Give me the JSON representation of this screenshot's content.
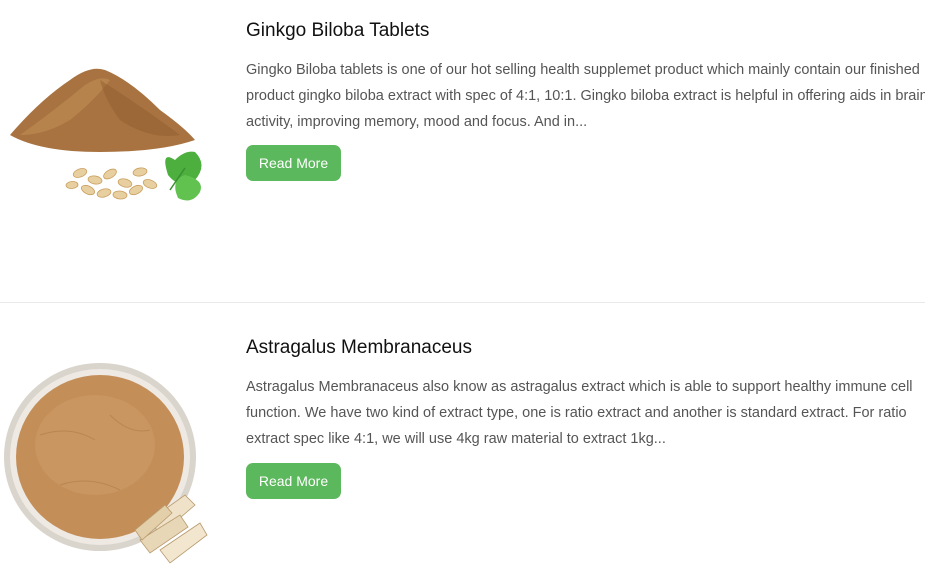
{
  "products": [
    {
      "title": "Ginkgo Biloba Tablets",
      "description": [
        "Gingko Biloba tablets is one of our hot selling health supplemet product which mainly contain our finished",
        "product gingko biloba extract with spec of 4:1, 10:1. Gingko biloba extract is helpful in offering aids in brain",
        "activity, improving memory, mood and focus. And in..."
      ],
      "button_label": "Read More",
      "image_alt": "ginkgo-powder-image"
    },
    {
      "title": "Astragalus Membranaceus",
      "description": [
        "Astragalus Membranaceus also know as astragalus extract which is able to support healthy immune cell",
        "function. We have two kind of extract type, one is ratio extract and another is standard extract. For ratio",
        "extract spec like 4:1, we will use 4kg raw material to extract 1kg..."
      ],
      "button_label": "Read More",
      "image_alt": "astragalus-powder-image"
    }
  ],
  "colors": {
    "button": "#5cb85c",
    "title": "#111111",
    "text": "#555555",
    "divider": "#e9e9e9"
  }
}
